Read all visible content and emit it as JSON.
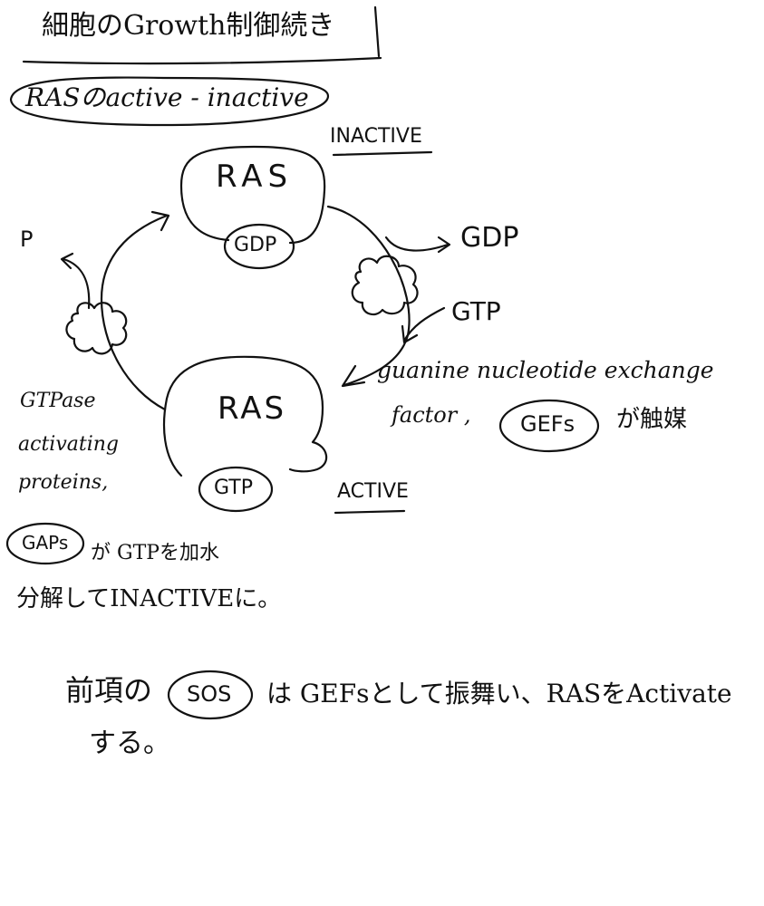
{
  "header": {
    "title": "細胞のGrowth制御続き",
    "subtitle": "RASのactive - inactive"
  },
  "cycle": {
    "inactive_label": "INACTIVE",
    "active_label": "ACTIVE",
    "ras_top": "RAS",
    "ras_bottom": "RAS",
    "gdp_bound": "GDP",
    "gtp_bound": "GTP",
    "gdp_released": "GDP",
    "gtp_added": "GTP",
    "phosphate": "P"
  },
  "gef_note": {
    "line1": "guanine nucleotide exchange",
    "line2_prefix": "factor ,",
    "gef_label": "GEFs",
    "line2_suffix": "が触媒"
  },
  "gap_note": {
    "line1": "GTPase",
    "line2": "activating",
    "line3": "proteins,",
    "gap_label": "GAPs",
    "line4_suffix": "が GTPを加水",
    "line5": "分解してINACTIVEに。"
  },
  "sos_note": {
    "prefix": "前項の",
    "sos_label": "SOS",
    "suffix": "は GEFsとして振舞い、RASをActivate",
    "line2": "する。"
  }
}
